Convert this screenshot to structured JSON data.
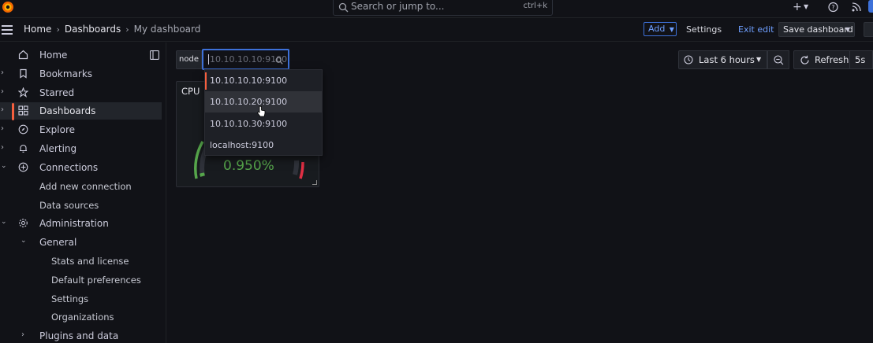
{
  "topbar": {
    "search_placeholder": "Search or jump to...",
    "search_shortcut": "ctrl+k",
    "plus_label": "+",
    "icons": [
      "grafana-logo-icon",
      "search-icon",
      "plus-icon",
      "help-icon",
      "news-icon"
    ]
  },
  "breadcrumbs": [
    "Home",
    "Dashboards",
    "My dashboard"
  ],
  "toolbar": {
    "add_label": "Add",
    "settings_label": "Settings",
    "exit_edit_label": "Exit edit",
    "save_label": "Save dashboard"
  },
  "sidebar": {
    "items": [
      {
        "label": "Home",
        "icon": "home-icon",
        "expandable": false
      },
      {
        "label": "Bookmarks",
        "icon": "bookmark-icon",
        "expandable": true
      },
      {
        "label": "Starred",
        "icon": "star-icon",
        "expandable": true
      },
      {
        "label": "Dashboards",
        "icon": "apps-icon",
        "expandable": true,
        "active": true
      },
      {
        "label": "Explore",
        "icon": "compass-icon",
        "expandable": true
      },
      {
        "label": "Alerting",
        "icon": "bell-icon",
        "expandable": true
      },
      {
        "label": "Connections",
        "icon": "connections-icon",
        "expandable": true,
        "expanded": true
      },
      {
        "label": "Add new connection"
      },
      {
        "label": "Data sources"
      },
      {
        "label": "Administration",
        "icon": "cog-icon",
        "expandable": true,
        "expanded": true
      },
      {
        "label": "General",
        "expanded": true
      },
      {
        "label": "Stats and license"
      },
      {
        "label": "Default preferences"
      },
      {
        "label": "Settings"
      },
      {
        "label": "Organizations"
      },
      {
        "label": "Plugins and data"
      }
    ]
  },
  "variable": {
    "label": "node",
    "placeholder": "10.10.10.10:9100",
    "options": [
      "10.10.10.10:9100",
      "10.10.10.20:9100",
      "10.10.10.30:9100",
      "localhost:9100"
    ],
    "selected_index": 0,
    "hovered_index": 1
  },
  "time_controls": {
    "range_label": "Last 6 hours",
    "refresh_label": "Refresh",
    "interval_label": "5s"
  },
  "panel": {
    "title": "CPU",
    "value": "0.950%",
    "gauge_fraction": 0.0095,
    "value_color": "#56a64b",
    "threshold_colors": [
      "#56a64b",
      "#e02f44"
    ]
  },
  "colors": {
    "accent": "#f55f3e",
    "primary_blue": "#3d71d9",
    "background": "#111217"
  }
}
